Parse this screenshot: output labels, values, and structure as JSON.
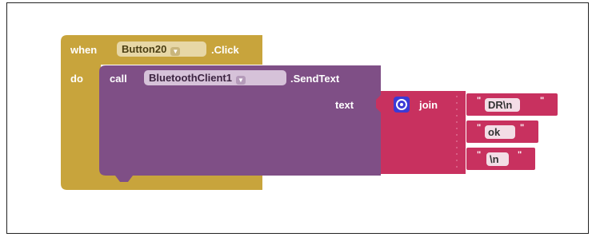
{
  "event_block": {
    "when_label": "when",
    "component": "Button20",
    "event": ".Click",
    "do_label": "do"
  },
  "call_block": {
    "call_label": "call",
    "component": "BluetoothClient1",
    "method": ".SendText",
    "arg_label": "text"
  },
  "join_block": {
    "label": "join",
    "items": [
      {
        "quote_open": "\"",
        "value": "DR\\n",
        "quote_close": "\""
      },
      {
        "quote_open": "\"",
        "value": "ok",
        "quote_close": "\""
      },
      {
        "quote_open": "\"",
        "value": "\\n",
        "quote_close": "\""
      }
    ]
  },
  "colors": {
    "event": "#c8a43c",
    "procedure_call": "#7f4f86",
    "text": "#c8315f",
    "mutator": "#3b3ad6"
  },
  "icons": {
    "dropdown": "dropdown-triangle-icon",
    "mutator": "gear-icon"
  }
}
